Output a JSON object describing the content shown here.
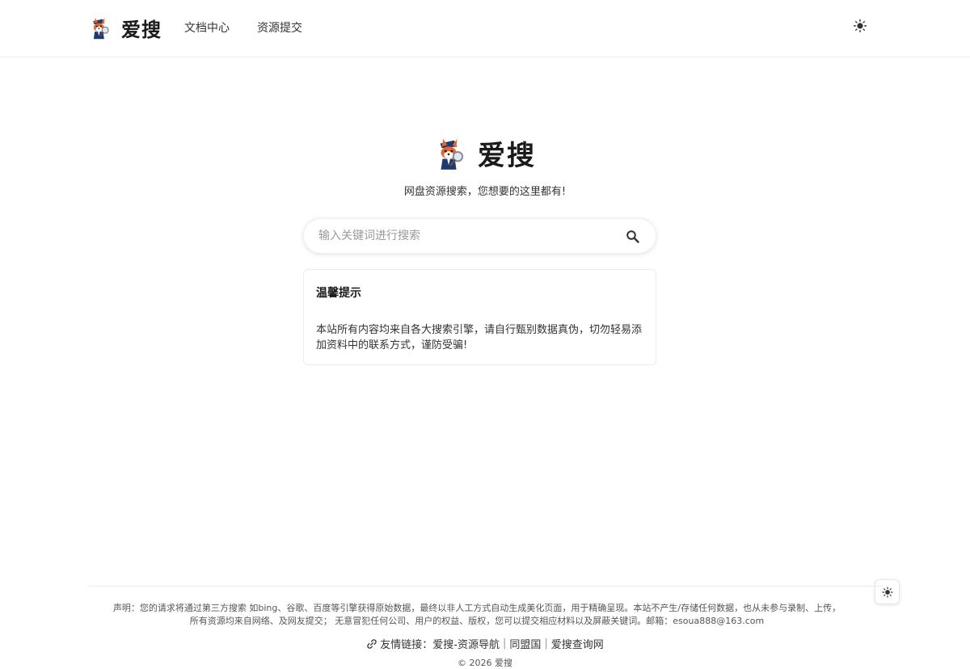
{
  "header": {
    "brand_name": "爱搜",
    "nav": [
      {
        "label": "文档中心"
      },
      {
        "label": "资源提交"
      }
    ],
    "theme_icon": "sun-icon"
  },
  "hero": {
    "title": "爱搜",
    "subtitle": "网盘资源搜索，您想要的这里都有!"
  },
  "search": {
    "placeholder": "输入关键词进行搜索",
    "value": "",
    "icon": "search-icon"
  },
  "notice": {
    "title": "温馨提示",
    "body": "本站所有内容均来自各大搜索引擎，请自行甄别数据真伪，切勿轻易添加资料中的联系方式，谨防受骗!"
  },
  "footer": {
    "disclaimer_line1": "声明：您的请求将通过第三方搜索 如bing、谷歌、百度等引擎获得原始数据，最终以非人工方式自动生成美化页面，用于精确呈现。本站不产生/存储任何数据，也从未参与录制、上传，",
    "disclaimer_line2": "所有资源均来自网络、及网友提交；  无意冒犯任何公司、用户的权益、版权，您可以提交相应材料以及屏蔽关键词。邮箱：esoua888@163.com",
    "friends_label": "友情链接：",
    "friend_links": [
      {
        "label": "爱搜-资源导航"
      },
      {
        "label": "同盟国"
      },
      {
        "label": "爱搜查询网"
      }
    ],
    "separator": "|",
    "copyright": "© 2026 爱搜"
  },
  "colors": {
    "text_primary": "#1a1a1a",
    "border": "#ececec",
    "logo_orange": "#e8662c",
    "logo_navy": "#1f3a6e"
  }
}
